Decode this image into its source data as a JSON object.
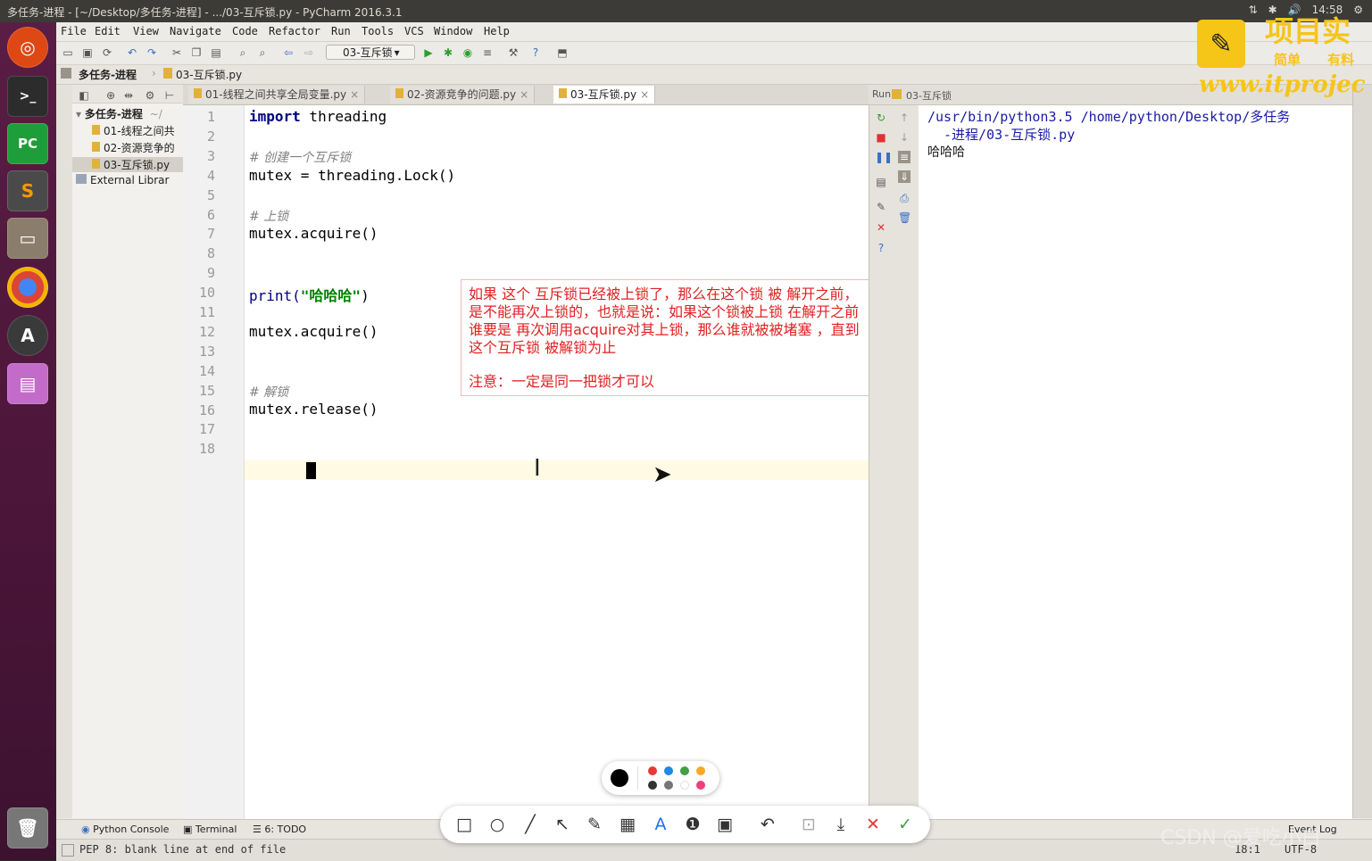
{
  "window_title": "多任务-进程 - [~/Desktop/多任务-进程] - .../03-互斥锁.py - PyCharm 2016.3.1",
  "system_tray": [
    "⇅",
    "✱",
    "🔊",
    "14:58",
    "⚙"
  ],
  "menu": [
    "File",
    "Edit",
    "View",
    "Navigate",
    "Code",
    "Refactor",
    "Run",
    "Tools",
    "VCS",
    "Window",
    "Help"
  ],
  "run_config": "03-互斥锁",
  "breadcrumb": [
    "多任务-进程",
    "03-互斥锁.py"
  ],
  "project_tree": {
    "root": "多任务-进程",
    "root_path": "~/",
    "files": [
      "01-线程之间共",
      "02-资源竞争的",
      "03-互斥锁.py"
    ],
    "external": "External Librar"
  },
  "tabs": [
    {
      "label": "01-线程之间共享全局变量.py",
      "active": false
    },
    {
      "label": "02-资源竞争的问题.py",
      "active": false
    },
    {
      "label": "03-互斥锁.py",
      "active": true
    }
  ],
  "tab_close": "×",
  "code_lines": [
    {
      "n": "1",
      "text": "import threading"
    },
    {
      "n": "2",
      "text": ""
    },
    {
      "n": "3",
      "text": "# 创建一个互斥锁"
    },
    {
      "n": "4",
      "text": "mutex = threading.Lock()"
    },
    {
      "n": "5",
      "text": ""
    },
    {
      "n": "6",
      "text": "# 上锁"
    },
    {
      "n": "7",
      "text": "mutex.acquire()"
    },
    {
      "n": "8",
      "text": ""
    },
    {
      "n": "9",
      "text": ""
    },
    {
      "n": "10",
      "text": "print(\"哈哈哈\")"
    },
    {
      "n": "11",
      "text": ""
    },
    {
      "n": "12",
      "text": "mutex.acquire()"
    },
    {
      "n": "13",
      "text": ""
    },
    {
      "n": "14",
      "text": ""
    },
    {
      "n": "15",
      "text": "# 解锁"
    },
    {
      "n": "16",
      "text": "mutex.release()"
    },
    {
      "n": "17",
      "text": ""
    },
    {
      "n": "18",
      "text": ""
    }
  ],
  "code_parts": {
    "import_kw": "import",
    "import_rest": " threading",
    "comment_lock_create": "# 创建一个互斥锁",
    "line4": "mutex = threading.Lock()",
    "comment_lock": "# 上锁",
    "line7": "mutex.acquire()",
    "print_fn": "print(",
    "print_str": "\"哈哈哈\"",
    "print_close": ")",
    "line12": "mutex.acquire()",
    "comment_unlock": "# 解锁",
    "line16": "mutex.release()"
  },
  "annotation": {
    "line1": "如果 这个 互斥锁已经被上锁了，那么在这个锁 被 解开之前，",
    "line2": "是不能再次上锁的，也就是说：如果这个锁被上锁 在解开之前",
    "line3": "谁要是 再次调用acquire对其上锁，那么谁就被被堵塞 ，直到",
    "line4": "这个互斥锁 被解锁为止",
    "line5": "注意：一定是同一把锁才可以"
  },
  "run_panel": {
    "label": "Run",
    "config": "03-互斥锁",
    "output_line1": "/usr/bin/python3.5 /home/python/Desktop/多任务",
    "output_line2": "-进程/03-互斥锁.py",
    "output_line3": "哈哈哈"
  },
  "tool_windows": [
    "Python Console",
    "Terminal",
    "6: TODO"
  ],
  "status": {
    "message": "PEP 8: blank line at end of file",
    "position": "18:1",
    "encoding": "UTF-8",
    "event_log": "Event Log"
  },
  "logo": {
    "title": "项目实",
    "sub1": "简单",
    "sub2": "有料",
    "url": "www.itprojec"
  },
  "watermark": "CSDN @爱吃小白",
  "colors": {
    "annotation_red": "#e02020",
    "keyword": "#000080",
    "string": "#008000",
    "comment": "#808080",
    "console_text": "#1a1aa6",
    "launcher": "#4a1538"
  },
  "palette_colors": [
    "#e53935",
    "#1e88e5",
    "#43a047",
    "#f9a825",
    "#333333",
    "#757575",
    "#ffffff",
    "#ec407a"
  ],
  "draw_tools": [
    "rectangle-icon",
    "ellipse-icon",
    "line-icon",
    "arrow-icon",
    "pencil-icon",
    "mosaic-icon",
    "text-icon",
    "number-icon",
    "blur-icon",
    "undo-icon",
    "pin-icon",
    "download-icon",
    "close-icon",
    "confirm-icon"
  ]
}
